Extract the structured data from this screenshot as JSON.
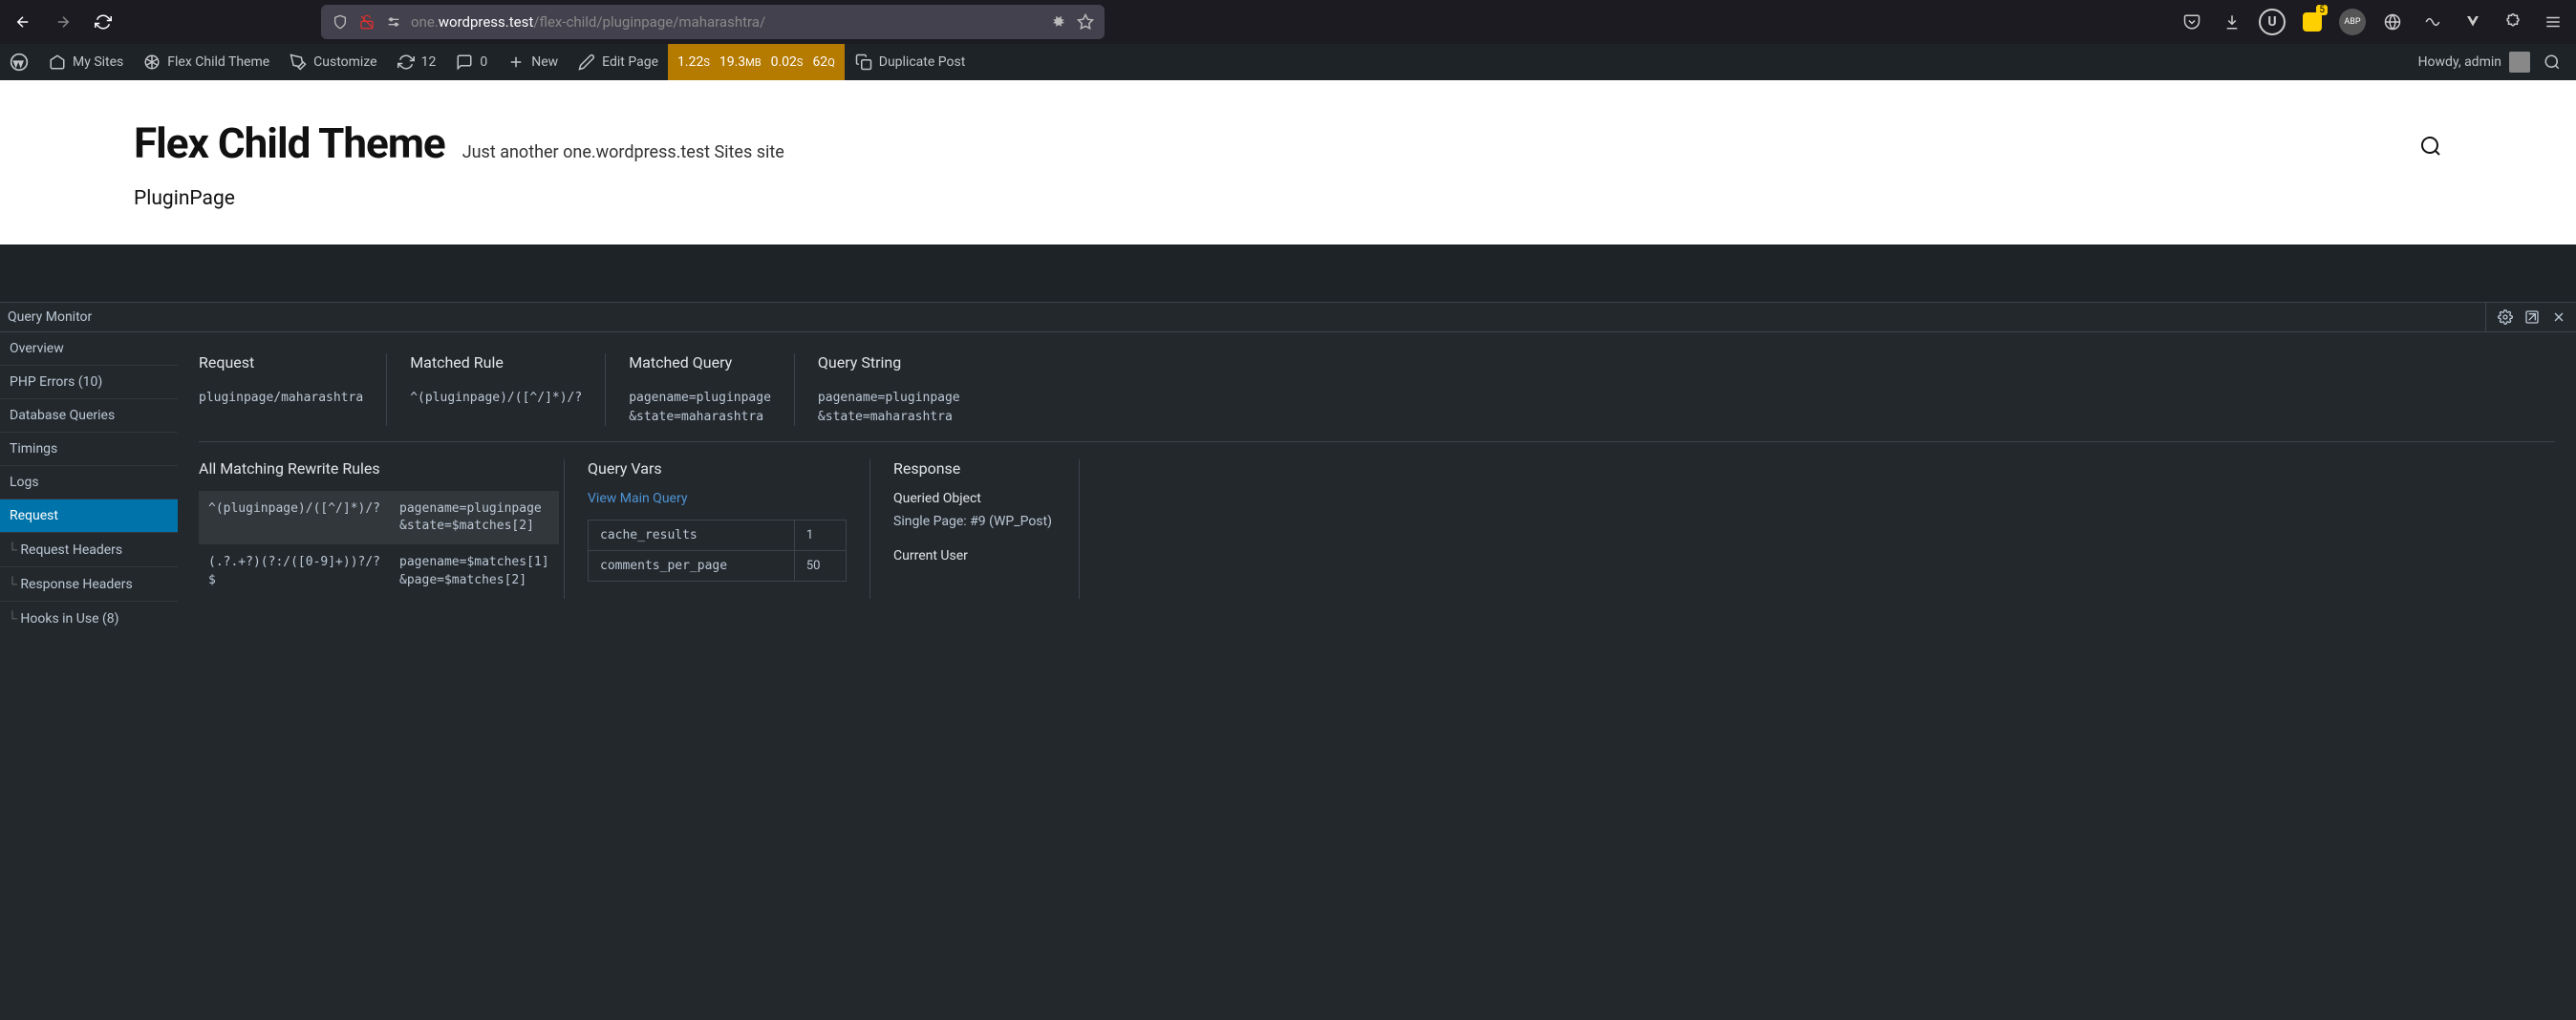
{
  "browser": {
    "url_dim": "one.",
    "url_domain": "wordpress.test",
    "url_path": "/flex-child/pluginpage/maharashtra/",
    "badge_count": "5"
  },
  "wp_bar": {
    "my_sites": "My Sites",
    "theme_name": "Flex Child Theme",
    "customize": "Customize",
    "updates": "12",
    "comments": "0",
    "new_label": "New",
    "edit_page": "Edit Page",
    "stats_time": "1.22",
    "stats_time_unit": "S",
    "stats_mem": "19.3",
    "stats_mem_unit": "MB",
    "stats_dur": "0.02",
    "stats_dur_unit": "S",
    "stats_q": "62",
    "stats_q_unit": "Q",
    "duplicate": "Duplicate Post",
    "howdy": "Howdy, admin"
  },
  "site": {
    "title": "Flex Child Theme",
    "tagline": "Just another one.wordpress.test Sites site",
    "page_title": "PluginPage"
  },
  "qm": {
    "title": "Query Monitor",
    "sidebar": {
      "overview": "Overview",
      "php_errors": "PHP Errors (10)",
      "db_queries": "Database Queries",
      "timings": "Timings",
      "logs": "Logs",
      "request": "Request",
      "request_headers": "Request Headers",
      "response_headers": "Response Headers",
      "hooks": "Hooks in Use (8)"
    },
    "top": {
      "request_h": "Request",
      "request_v": "pluginpage/maharashtra",
      "rule_h": "Matched Rule",
      "rule_v": "^(pluginpage)/([^/]*)/?",
      "mquery_h": "Matched Query",
      "mquery_v1": "pagename=pluginpage",
      "mquery_v2": "&state=maharashtra",
      "qstring_h": "Query String",
      "qstring_v1": "pagename=pluginpage",
      "qstring_v2": "&state=maharashtra"
    },
    "rewrite": {
      "heading": "All Matching Rewrite Rules",
      "rows": [
        {
          "pattern": "^(pluginpage)/([^/]*)/?",
          "query": "pagename=pluginpage\n&state=$matches[2]"
        },
        {
          "pattern": "(.?.+?)(?:/([0-9]+))?/?$",
          "query": "pagename=$matches[1]\n&page=$matches[2]"
        }
      ]
    },
    "query_vars": {
      "heading": "Query Vars",
      "link": "View Main Query",
      "rows": [
        {
          "k": "cache_results",
          "v": "1"
        },
        {
          "k": "comments_per_page",
          "v": "50"
        }
      ]
    },
    "response": {
      "heading": "Response",
      "queried_label": "Queried Object",
      "queried_val": "Single Page: #9 (WP_Post)",
      "user_label": "Current User"
    }
  }
}
